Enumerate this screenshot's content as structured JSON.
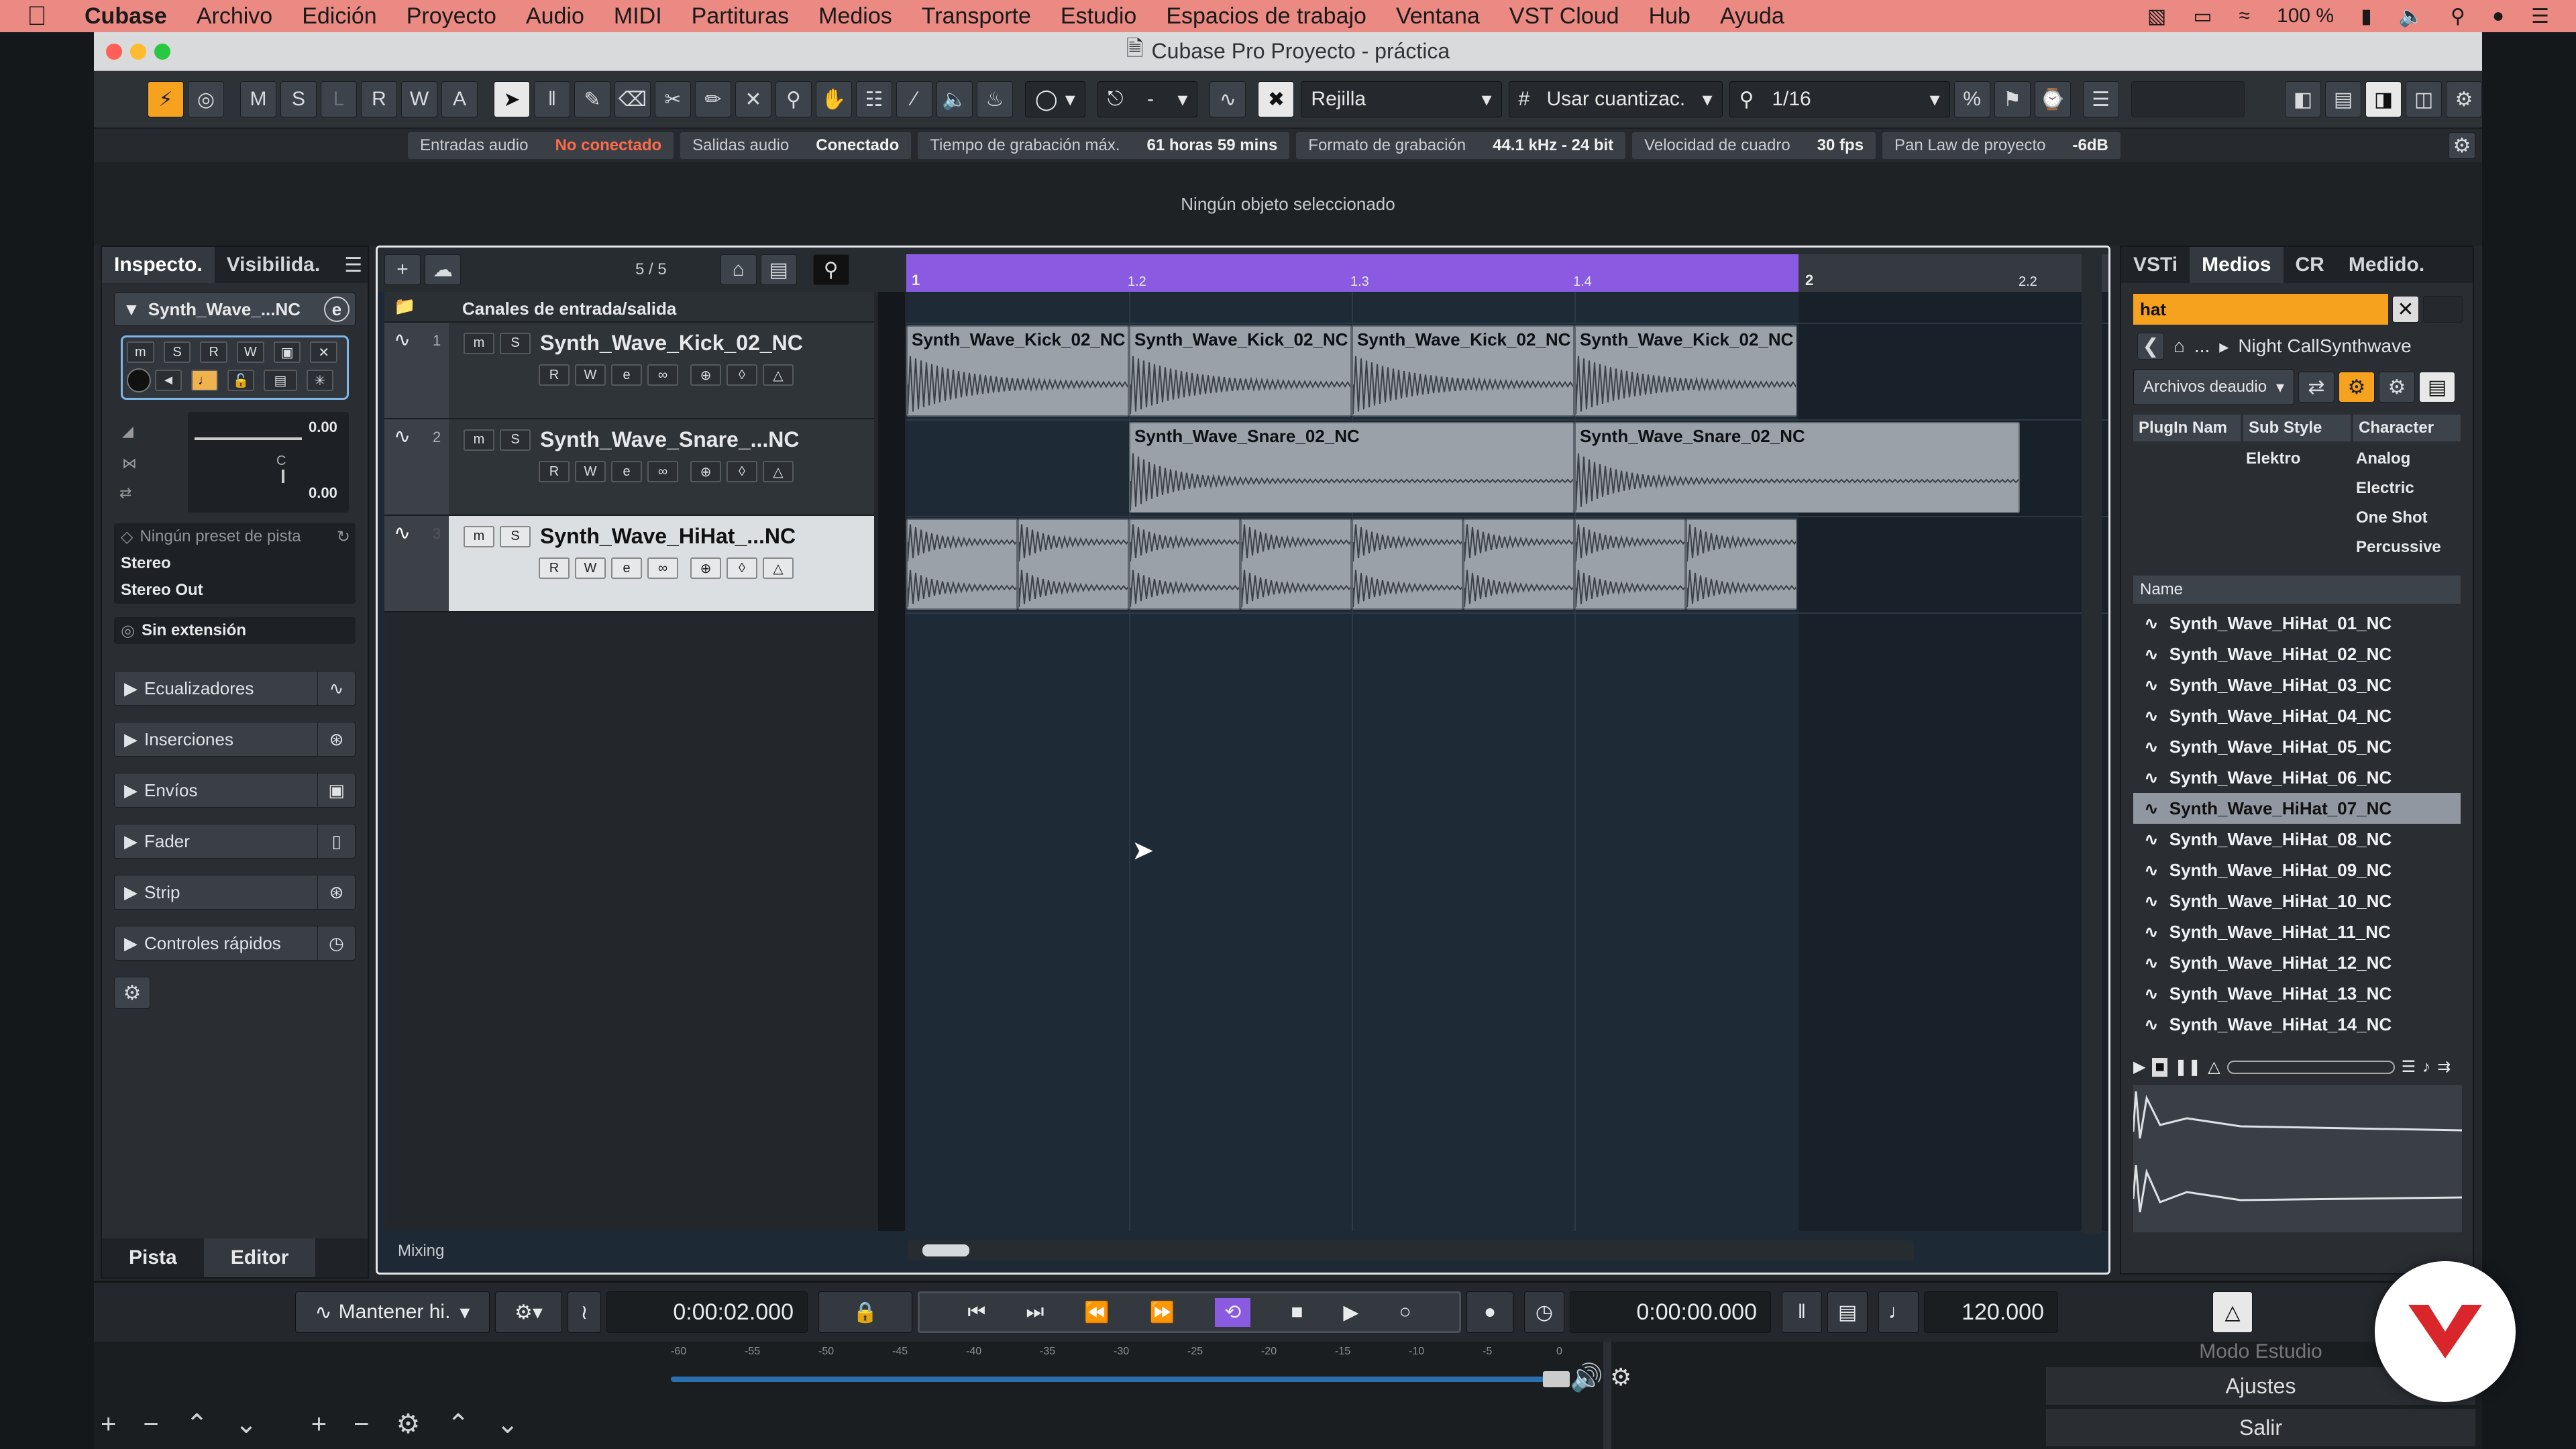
{
  "menubar": {
    "app": "Cubase",
    "items": [
      "Archivo",
      "Edición",
      "Proyecto",
      "Audio",
      "MIDI",
      "Partituras",
      "Medios",
      "Transporte",
      "Estudio",
      "Espacios de trabajo",
      "Ventana",
      "VST Cloud",
      "Hub",
      "Ayuda"
    ],
    "battery": "100 %"
  },
  "window": {
    "title": "Cubase Pro Proyecto - práctica"
  },
  "toolbar": {
    "mode_buttons": [
      "M",
      "S",
      "L",
      "R",
      "W",
      "A"
    ],
    "snap_type": "Rejilla",
    "quantize_type": "Usar cuantizac.",
    "quantize_value": "1/16"
  },
  "status": {
    "audio_in_label": "Entradas audio",
    "audio_in_value": "No conectado",
    "audio_out_label": "Salidas audio",
    "audio_out_value": "Conectado",
    "rec_time_label": "Tiempo de grabación máx.",
    "rec_time_value": "61 horas 59 mins",
    "rec_format_label": "Formato de grabación",
    "rec_format_value": "44.1 kHz - 24 bit",
    "frame_rate_label": "Velocidad de cuadro",
    "frame_rate_value": "30 fps",
    "panlaw_label": "Pan Law de proyecto",
    "panlaw_value": "-6dB"
  },
  "infoline": {
    "text": "Ningún objeto seleccionado"
  },
  "inspector": {
    "tab_inspector": "Inspecto.",
    "tab_visibility": "Visibilida.",
    "track_name": "Synth_Wave_...NC",
    "volume": "0.00",
    "pan": "C",
    "delay": "0.00",
    "preset": "Ningún preset de pista",
    "input": "Stereo",
    "output": "Stereo Out",
    "extension": "Sin extensión",
    "sections": [
      "Ecualizadores",
      "Inserciones",
      "Envíos",
      "Fader",
      "Strip",
      "Controles rápidos"
    ],
    "bottom_tab_track": "Pista",
    "bottom_tab_editor": "Editor"
  },
  "project": {
    "track_count": "5 / 5",
    "folder_name": "Canales de entrada/salida",
    "tracks": [
      {
        "num": "1",
        "name": "Synth_Wave_Kick_02_NC"
      },
      {
        "num": "2",
        "name": "Synth_Wave_Snare_...NC"
      },
      {
        "num": "3",
        "name": "Synth_Wave_HiHat_...NC"
      }
    ],
    "ruler": [
      "1",
      "1.2",
      "1.3",
      "1.4",
      "2",
      "2.2"
    ],
    "kick_events": [
      "Synth_Wave_Kick_02_NC",
      "Synth_Wave_Kick_02_NC",
      "Synth_Wave_Kick_02_NC",
      "Synth_Wave_Kick_02_NC"
    ],
    "snare_events": [
      "Synth_Wave_Snare_02_NC",
      "Synth_Wave_Snare_02_NC"
    ],
    "hihat_event_count": 8,
    "bottom_label": "Mixing"
  },
  "media": {
    "tabs": [
      "VSTi",
      "Medios",
      "CR",
      "Medido."
    ],
    "search": "hat",
    "path": "Night CallSynthwave",
    "filter_dropdown": "Archivos deaudio",
    "filter_cols": [
      "PlugIn Nam",
      "Sub Style",
      "Character"
    ],
    "sub_style": "Elektro",
    "characters": [
      "Analog",
      "Electric",
      "One Shot",
      "Percussive"
    ],
    "list_header": "Name",
    "files": [
      "Synth_Wave_HiHat_01_NC",
      "Synth_Wave_HiHat_02_NC",
      "Synth_Wave_HiHat_03_NC",
      "Synth_Wave_HiHat_04_NC",
      "Synth_Wave_HiHat_05_NC",
      "Synth_Wave_HiHat_06_NC",
      "Synth_Wave_HiHat_07_NC",
      "Synth_Wave_HiHat_08_NC",
      "Synth_Wave_HiHat_09_NC",
      "Synth_Wave_HiHat_10_NC",
      "Synth_Wave_HiHat_11_NC",
      "Synth_Wave_HiHat_12_NC",
      "Synth_Wave_HiHat_13_NC",
      "Synth_Wave_HiHat_14_NC"
    ],
    "selected_file": "Synth_Wave_HiHat_07_NC"
  },
  "transport": {
    "mode": "Mantener hi.",
    "left_time": "0:00:02.000",
    "right_time": "0:00:00.000",
    "tempo": "120.000"
  },
  "bottom": {
    "studio_mode": "Modo Estudio",
    "settings": "Ajustes",
    "exit": "Salir",
    "meter_scale": [
      "-60",
      "-55",
      "-50",
      "-45",
      "-40",
      "-35",
      "-30",
      "-25",
      "-20",
      "-15",
      "-10",
      "-5",
      "0"
    ]
  },
  "colors": {
    "cycle": "#8a5ae0",
    "accent_orange": "#f6a21e",
    "event": "#9aa1a8",
    "brand_red": "#d9262b"
  }
}
